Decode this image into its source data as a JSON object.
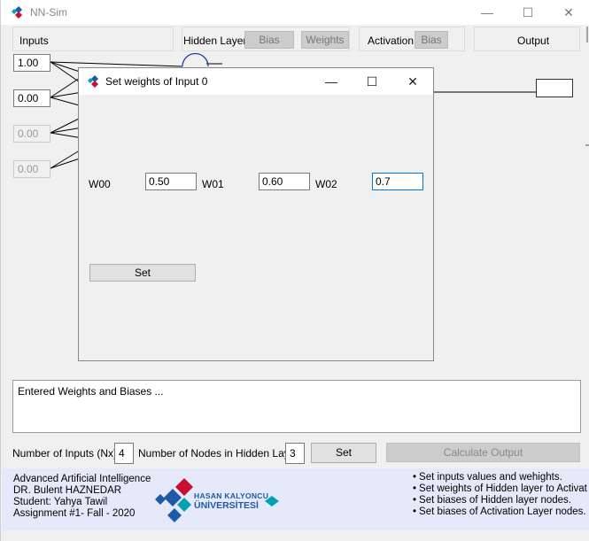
{
  "window": {
    "title": "NN-Sim",
    "minimize": "—",
    "maximize": "☐",
    "close": "✕"
  },
  "header": {
    "inputs_label": "Inputs",
    "hidden_label": "Hidden Layer",
    "hidden_bias_btn": "Bias",
    "hidden_weights_btn": "Weights",
    "activation_label": "Activation",
    "activation_bias_btn": "Bias",
    "output_label": "Output"
  },
  "inputs": {
    "values": [
      "1.00",
      "0.00",
      "0.00",
      "0.00"
    ]
  },
  "log": {
    "text": "Entered Weights and Biases ..."
  },
  "controls": {
    "num_inputs_label": "Number of Inputs (Nx)",
    "num_inputs_value": "4",
    "num_hidden_label": "Number of Nodes in Hidden Layer",
    "num_hidden_value": "3",
    "set_label": "Set",
    "calculate_label": "Calculate Output"
  },
  "footer": {
    "course": "Advanced Artificial Intelligence",
    "instructor": "DR. Bulent HAZNEDAR",
    "student": "Student: Yahya Tawil",
    "assignment": "Assignment #1- Fall - 2020",
    "logo_line1": "HASAN KALYONCU",
    "logo_line2": "ÜNİVERSİTESİ",
    "notes": [
      "Set inputs values and wehights.",
      "Set weights of Hidden layer to Activat",
      "Set biases of Hidden layer nodes.",
      "Set biases of Activation Layer nodes."
    ]
  },
  "dialog": {
    "title": "Set weights of Input 0",
    "minimize": "—",
    "maximize": "☐",
    "close": "✕",
    "w00_label": "W00",
    "w00_value": "0.50",
    "w01_label": "W01",
    "w01_value": "0.60",
    "w02_label": "W02",
    "w02_value": "0.7",
    "set_label": "Set"
  },
  "colors": {
    "logo_red": "#c8102e",
    "logo_blue": "#1e5aa8",
    "logo_cyan": "#00a3b4",
    "footer_bg": "#e6e9fa"
  }
}
